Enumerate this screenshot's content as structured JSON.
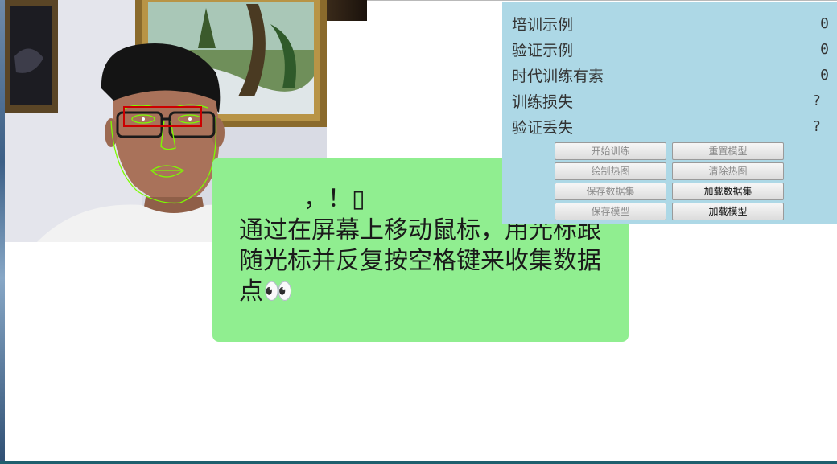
{
  "training_panel": {
    "stats": [
      {
        "label": "培训示例",
        "value": "0"
      },
      {
        "label": "验证示例",
        "value": "0"
      },
      {
        "label": "时代训练有素",
        "value": "0"
      },
      {
        "label": "训练损失",
        "value": "?"
      },
      {
        "label": "验证丢失",
        "value": "?"
      }
    ],
    "buttons": {
      "start_training": "开始训练",
      "reset_model": "重置模型",
      "draw_heatmap": "绘制热图",
      "clear_heatmap": "清除热图",
      "save_dataset": "保存数据集",
      "load_dataset": "加载数据集",
      "save_model": "保存模型",
      "load_model": "加载模型"
    }
  },
  "instruction": {
    "heading": "，！▯",
    "body": "通过在屏幕上移动鼠标，用光标跟随光标并反复按空格键来收集数据点👀"
  },
  "colors": {
    "panel_bg": "#add8e6",
    "instruction_bg": "#90ee90",
    "face_mesh": "#7cfc00",
    "eye_box": "#cc0000"
  }
}
